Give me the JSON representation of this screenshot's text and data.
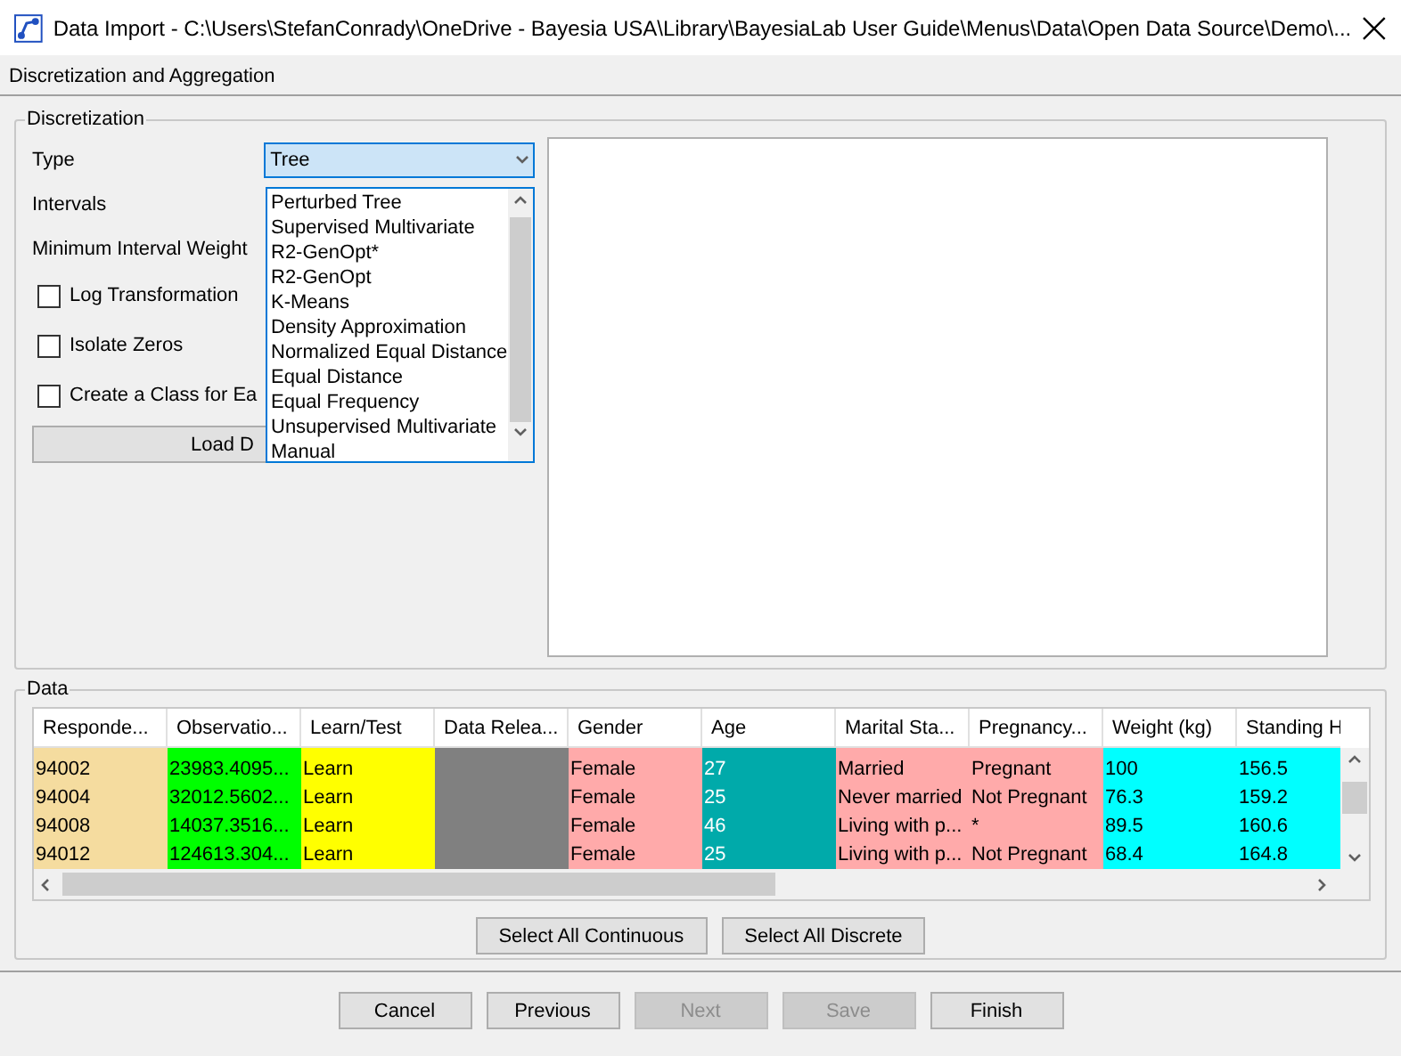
{
  "window": {
    "title": "Data Import - C:\\Users\\StefanConrady\\OneDrive - Bayesia USA\\Library\\BayesiaLab User Guide\\Menus\\Data\\Open Data Source\\Demo\\..."
  },
  "step_title": "Discretization and Aggregation",
  "discretization": {
    "legend": "Discretization",
    "type_label": "Type",
    "type_value": "Tree",
    "type_options": [
      "Perturbed Tree",
      "Supervised Multivariate",
      "R2-GenOpt*",
      "R2-GenOpt",
      "K-Means",
      "Density Approximation",
      "Normalized Equal Distance",
      "Equal Distance",
      "Equal Frequency",
      "Unsupervised Multivariate",
      "Manual"
    ],
    "intervals_label": "Intervals",
    "min_weight_label": "Minimum Interval Weight",
    "checkboxes": [
      {
        "label": "Log Transformation",
        "checked": false
      },
      {
        "label": "Isolate Zeros",
        "checked": false
      },
      {
        "label": "Create a Class for Ea",
        "checked": false
      }
    ],
    "load_button": "Load D"
  },
  "data": {
    "legend": "Data",
    "columns": [
      {
        "header": "Responde...",
        "color": "#f5dc9f"
      },
      {
        "header": "Observatio...",
        "color": "#00ff00"
      },
      {
        "header": "Learn/Test",
        "color": "#ffff00"
      },
      {
        "header": "Data Relea...",
        "color": "#808080"
      },
      {
        "header": "Gender",
        "color": "#ffaaaa"
      },
      {
        "header": "Age",
        "color": "#00aaaa"
      },
      {
        "header": "Marital Sta...",
        "color": "#ffaaaa"
      },
      {
        "header": "Pregnancy...",
        "color": "#ffaaaa"
      },
      {
        "header": "Weight (kg)",
        "color": "#00ffff"
      },
      {
        "header": "Standing H",
        "color": "#00ffff"
      }
    ],
    "rows": [
      [
        "94002",
        "23983.4095...",
        "Learn",
        null,
        "Female",
        "27",
        "Married",
        "Pregnant",
        "100",
        "156.5"
      ],
      [
        "94004",
        "32012.5602...",
        "Learn",
        null,
        "Female",
        "25",
        "Never married",
        "Not Pregnant",
        "76.3",
        "159.2"
      ],
      [
        "94008",
        "14037.3516...",
        "Learn",
        null,
        "Female",
        "46",
        "Living with p...",
        "*",
        "89.5",
        "160.6"
      ],
      [
        "94012",
        "124613.304...",
        "Learn",
        null,
        "Female",
        "25",
        "Living with p...",
        "Not Pregnant",
        "68.4",
        "164.8"
      ]
    ],
    "select_buttons": [
      "Select All Continuous",
      "Select All Discrete"
    ]
  },
  "footer_buttons": [
    {
      "label": "Cancel",
      "disabled": false
    },
    {
      "label": "Previous",
      "disabled": false
    },
    {
      "label": "Next",
      "disabled": true
    },
    {
      "label": "Save",
      "disabled": true
    },
    {
      "label": "Finish",
      "disabled": false
    }
  ]
}
